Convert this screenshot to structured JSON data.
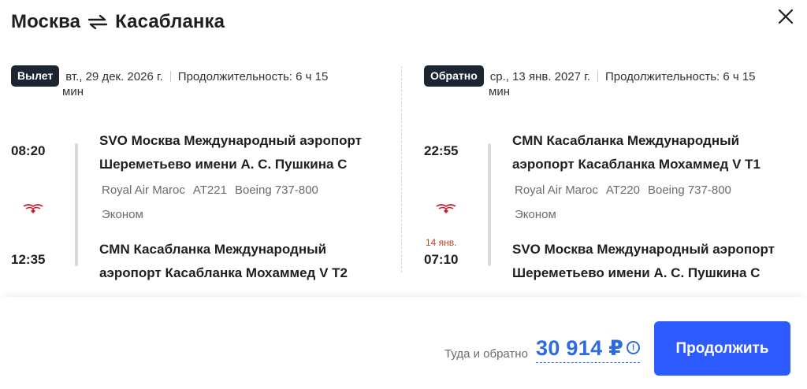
{
  "header": {
    "from_city": "Москва",
    "to_city": "Касабланка",
    "swap_icon": "swap-arrows-icon",
    "close_icon": "close-icon"
  },
  "outbound": {
    "badge": "Вылет",
    "date": "вт., 29 дек. 2026 г.",
    "duration": "Продолжительность: 6 ч 15",
    "duration_wrap": "мин",
    "departure_time": "08:20",
    "departure_airport": "SVO Москва Международный аэропорт Шереметьево имени А. С. Пушкина C",
    "airline": "Royal Air Maroc",
    "flight_number": "AT221",
    "aircraft": "Boeing 737-800",
    "cabin_class": "Эконом",
    "arrival_date_note": "",
    "arrival_time": "12:35",
    "arrival_airport": "CMN Касабланка Международный аэропорт Касабланка Мохаммед V T2"
  },
  "return": {
    "badge": "Обратно",
    "date": "ср., 13 янв. 2027 г.",
    "duration": "Продолжительность: 6 ч 15",
    "duration_wrap": "мин",
    "departure_time": "22:55",
    "departure_airport": "CMN Касабланка Международный аэропорт Касабланка Мохаммед V T1",
    "airline": "Royal Air Maroc",
    "flight_number": "AT220",
    "aircraft": "Boeing 737-800",
    "cabin_class": "Эконом",
    "arrival_date_note": "14 янв.",
    "arrival_time": "07:10",
    "arrival_airport": "SVO Москва Международный аэропорт Шереметьево имени А. С. Пушкина C"
  },
  "footer": {
    "total_label": "Туда и обратно",
    "price": "30 914 ₽",
    "continue_label": "Продолжить"
  },
  "colors": {
    "accent": "#2d5bff",
    "price": "#2d6cdf",
    "badge_bg": "#1d2533",
    "date_change": "#c0442a",
    "airline_logo": "#c8202f"
  }
}
